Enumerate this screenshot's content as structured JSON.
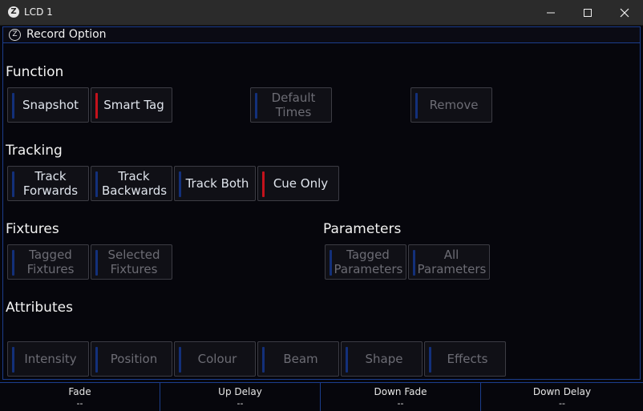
{
  "window": {
    "logo": "Z",
    "title": "LCD 1"
  },
  "panel": {
    "logo": "Z",
    "title": "Record Option"
  },
  "sections": {
    "function": {
      "label": "Function",
      "buttons": [
        {
          "label": "Snapshot",
          "state": "normal"
        },
        {
          "label": "Smart Tag",
          "state": "active"
        },
        {
          "label": "Default Times",
          "state": "disabled"
        },
        {
          "label": "Remove",
          "state": "disabled"
        }
      ]
    },
    "tracking": {
      "label": "Tracking",
      "buttons": [
        {
          "label": "Track Forwards",
          "state": "normal"
        },
        {
          "label": "Track Backwards",
          "state": "normal"
        },
        {
          "label": "Track Both",
          "state": "normal"
        },
        {
          "label": "Cue Only",
          "state": "active"
        }
      ]
    },
    "fixtures": {
      "label": "Fixtures",
      "buttons": [
        {
          "label": "Tagged Fixtures",
          "state": "disabled"
        },
        {
          "label": "Selected Fixtures",
          "state": "disabled"
        }
      ]
    },
    "parameters": {
      "label": "Parameters",
      "buttons": [
        {
          "label": "Tagged Parameters",
          "state": "disabled"
        },
        {
          "label": "All Parameters",
          "state": "disabled"
        }
      ]
    },
    "attributes": {
      "label": "Attributes",
      "buttons": [
        {
          "label": "Intensity",
          "state": "disabled"
        },
        {
          "label": "Position",
          "state": "disabled"
        },
        {
          "label": "Colour",
          "state": "disabled"
        },
        {
          "label": "Beam",
          "state": "disabled"
        },
        {
          "label": "Shape",
          "state": "disabled"
        },
        {
          "label": "Effects",
          "state": "disabled"
        }
      ]
    }
  },
  "footer": [
    {
      "label": "Fade",
      "value": "--"
    },
    {
      "label": "Up Delay",
      "value": "--"
    },
    {
      "label": "Down Fade",
      "value": "--"
    },
    {
      "label": "Down Delay",
      "value": "--"
    }
  ],
  "colors": {
    "accent_blue": "#1b3d8c",
    "active_red": "#c4121c",
    "indicator_blue": "#13307a"
  }
}
